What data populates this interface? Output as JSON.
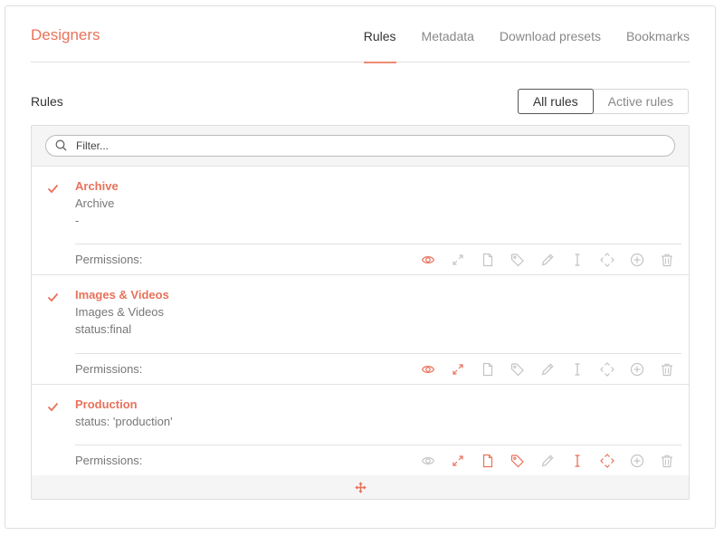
{
  "header": {
    "title": "Designers",
    "tabs": [
      {
        "label": "Rules",
        "active": true
      },
      {
        "label": "Metadata",
        "active": false
      },
      {
        "label": "Download presets",
        "active": false
      },
      {
        "label": "Bookmarks",
        "active": false
      }
    ]
  },
  "section": {
    "label": "Rules"
  },
  "toggle": {
    "all_label": "All rules",
    "active_label": "Active rules",
    "selected": "all"
  },
  "filter": {
    "placeholder": "Filter...",
    "value": ""
  },
  "permissions_label": "Permissions:",
  "permission_icons": [
    "eye-icon",
    "expand-icon",
    "file-icon",
    "tag-icon",
    "pencil-icon",
    "text-cursor-icon",
    "move-icon",
    "plus-circle-icon",
    "trash-icon"
  ],
  "rules": [
    {
      "name": "Archive",
      "lines": [
        "Archive",
        "-"
      ],
      "checked": true,
      "permissions": [
        true,
        false,
        false,
        false,
        false,
        false,
        false,
        false,
        false
      ]
    },
    {
      "name": "Images & Videos",
      "lines": [
        "Images & Videos",
        "status:final"
      ],
      "checked": true,
      "permissions": [
        true,
        true,
        false,
        false,
        false,
        false,
        false,
        false,
        false
      ]
    },
    {
      "name": "Production",
      "lines": [
        "status: 'production'"
      ],
      "checked": true,
      "permissions": [
        false,
        true,
        true,
        true,
        false,
        true,
        true,
        false,
        false
      ]
    }
  ],
  "colors": {
    "accent": "#e8725b",
    "inactive_icon": "#c4c4c4"
  },
  "add_icon": "move-add-icon"
}
